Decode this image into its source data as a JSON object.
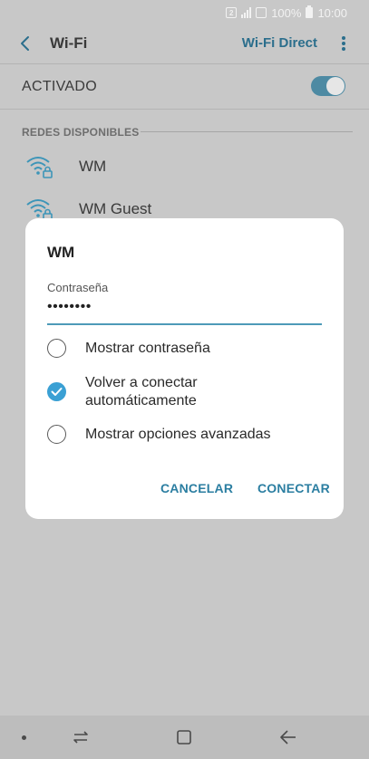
{
  "status_bar": {
    "battery": "100%",
    "time": "10:00",
    "sim_badge": "2"
  },
  "app_bar": {
    "title": "Wi-Fi",
    "action": "Wi-Fi Direct"
  },
  "wifi_toggle": {
    "label": "ACTIVADO",
    "state": "on"
  },
  "networks": {
    "header": "REDES DISPONIBLES",
    "items": [
      {
        "name": "WM"
      },
      {
        "name": "WM Guest"
      }
    ]
  },
  "dialog": {
    "title": "WM",
    "password_label": "Contraseña",
    "password_value": "••••••••",
    "options": [
      {
        "label": "Mostrar contraseña",
        "checked": false
      },
      {
        "label_line1": "Volver a conectar",
        "label_line2": "automáticamente",
        "checked": true
      },
      {
        "label": "Mostrar opciones avanzadas",
        "checked": false
      }
    ],
    "cancel_label": "CANCELAR",
    "connect_label": "CONECTAR"
  },
  "colors": {
    "accent": "#2b7ea1",
    "check": "#3aa0d4",
    "toggle": "#4d8aa3",
    "dim_background": "#c8c8c8"
  }
}
